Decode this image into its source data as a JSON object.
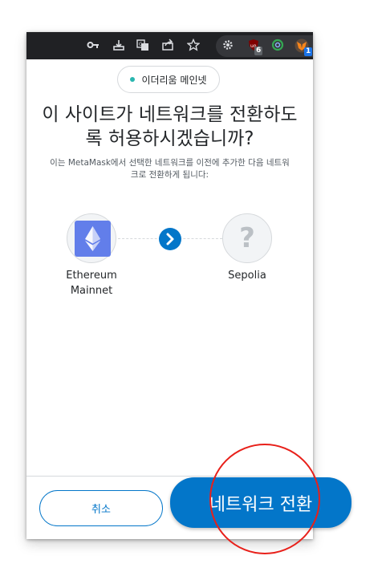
{
  "browser_toolbar": {
    "icons": [
      "key-icon",
      "install-icon",
      "translate-icon",
      "share-icon",
      "star-icon"
    ],
    "extensions": [
      {
        "icon": "gear-extension-icon"
      },
      {
        "icon": "ublock-icon",
        "badge": "6",
        "badge_color": "#5f6368"
      },
      {
        "icon": "ring-extension-icon"
      },
      {
        "icon": "metamask-fox-icon",
        "badge": "1",
        "badge_color": "#1a73e8"
      }
    ]
  },
  "network_indicator": {
    "label": "이더리움 메인넷",
    "dot_color": "#29b6af"
  },
  "heading": {
    "line1": "이 사이트가 네트워크를 전환하도",
    "line2": "록 허용하시겠습니까?"
  },
  "description": {
    "line1": "이는 MetaMask에서 선택한 네트워크를 이전에 추가한 다음 네트워",
    "line2": "크로 전환하게 됩니다:"
  },
  "from_network": {
    "name_line1": "Ethereum",
    "name_line2": "Mainnet",
    "icon": "ethereum-icon",
    "color": "#627eea"
  },
  "to_network": {
    "name": "Sepolia",
    "icon": "question-icon"
  },
  "buttons": {
    "cancel": "취소",
    "confirm": "네트워크 전환"
  },
  "colors": {
    "primary": "#0376c9",
    "annotation": "#e8201a"
  }
}
